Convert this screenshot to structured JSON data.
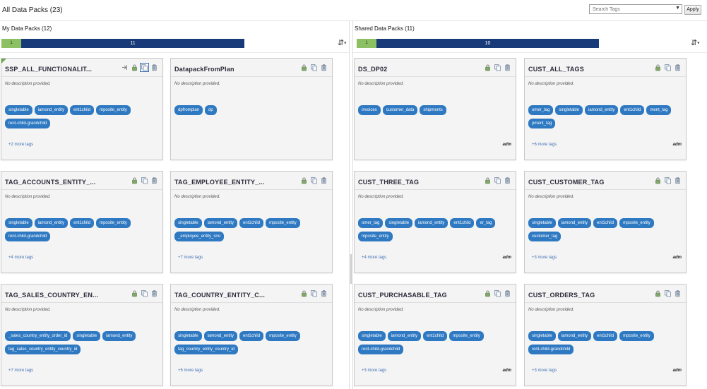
{
  "header": {
    "title": "All Data Packs (23)",
    "search_placeholder": "Search Tags",
    "apply_label": "Apply"
  },
  "left": {
    "title": "My Data Packs (12)",
    "bar": {
      "green_label": "1",
      "blue_label": "11"
    },
    "cards": [
      {
        "name": "SSP_ALL_FUNCTIONALIT...",
        "desc": "No description provided.",
        "tags": [
          "singletable",
          "iamond_entity",
          "ent1child",
          "mposite_entity",
          "rent-child-grandchild"
        ],
        "more": "+2 more tags",
        "owner": "",
        "icons": [
          "share",
          "lock",
          "copy",
          "trash"
        ],
        "new": true
      },
      {
        "name": "DatapackFromPlan",
        "desc": "No description provided.",
        "tags": [
          "dpfromplan",
          "dp"
        ],
        "more": "",
        "owner": "",
        "icons": [
          "lock",
          "copy",
          "trash"
        ],
        "new": false
      },
      {
        "name": "TAG_ACCOUNTS_ENTITY_...",
        "desc": "No description provided.",
        "tags": [
          "singletable",
          "iamond_entity",
          "ent1child",
          "mposite_entity",
          "rent-child-grandchild"
        ],
        "more": "+4 more tags",
        "owner": "",
        "icons": [
          "lock",
          "copy",
          "trash"
        ],
        "new": false
      },
      {
        "name": "TAG_EMPLOYEE_ENTITY_...",
        "desc": "No description provided.",
        "tags": [
          "singletable",
          "iamond_entity",
          "ent1child",
          "mposite_entity",
          "_employee_entity_sno"
        ],
        "more": "+7 more tags",
        "owner": "",
        "icons": [
          "lock",
          "copy",
          "trash"
        ],
        "new": false
      },
      {
        "name": "TAG_SALES_COUNTRY_EN...",
        "desc": "No description provided.",
        "tags": [
          "_sales_country_entity_order_id",
          "singletable",
          "iamond_entity",
          "tag_sales_country_entity_country_id"
        ],
        "more": "+7 more tags",
        "owner": "",
        "icons": [
          "lock",
          "copy",
          "trash"
        ],
        "new": false
      },
      {
        "name": "TAG_COUNTRY_ENTITY_C...",
        "desc": "No description provided.",
        "tags": [
          "singletable",
          "iamond_entity",
          "ent1child",
          "mposite_entity",
          "tag_country_entity_country_id"
        ],
        "more": "+5 more tags",
        "owner": "",
        "icons": [
          "lock",
          "copy",
          "trash"
        ],
        "new": false
      }
    ]
  },
  "right": {
    "title": "Shared Data Packs (11)",
    "bar": {
      "green_label": "1",
      "blue_label": "10"
    },
    "cards": [
      {
        "name": "DS_DP02",
        "desc": "No description provided.",
        "tags": [
          "invoices",
          "customer_data",
          "shipments"
        ],
        "more": "",
        "owner": "adm",
        "icons": [
          "lock",
          "copy",
          "trash"
        ],
        "new": false
      },
      {
        "name": "CUST_ALL_TAGS",
        "desc": "No description provided.",
        "tags": [
          "omer_tag",
          "singletable",
          "iamond_entity",
          "ent1child",
          "ment_tag",
          "pment_tag"
        ],
        "more": "+6 more tags",
        "owner": "adm",
        "icons": [
          "lock",
          "copy",
          "trash"
        ],
        "new": false
      },
      {
        "name": "CUST_THREE_TAG",
        "desc": "No description provided.",
        "tags": [
          "omer_tag",
          "singletable",
          "iamond_entity",
          "ent1child",
          "er_tag",
          "mposite_entity"
        ],
        "more": "+4 more tags",
        "owner": "adm",
        "icons": [
          "lock",
          "copy",
          "trash"
        ],
        "new": false
      },
      {
        "name": "CUST_CUSTOMER_TAG",
        "desc": "No description provided.",
        "tags": [
          "singletable",
          "iamond_entity",
          "ent1child",
          "mposite_entity",
          "customer_tag"
        ],
        "more": "+3 more tags",
        "owner": "adm",
        "icons": [
          "lock",
          "copy",
          "trash"
        ],
        "new": false
      },
      {
        "name": "CUST_PURCHASABLE_TAG",
        "desc": "No description provided.",
        "tags": [
          "singletable",
          "iamond_entity",
          "ent1child",
          "mposite_entity",
          "rent-child-grandchild"
        ],
        "more": "+3 more tags",
        "owner": "adm",
        "icons": [
          "lock",
          "copy",
          "trash"
        ],
        "new": false
      },
      {
        "name": "CUST_ORDERS_TAG",
        "desc": "No description provided.",
        "tags": [
          "singletable",
          "iamond_entity",
          "ent1child",
          "mposite_entity",
          "rent-child-grandchild"
        ],
        "more": "+3 more tags",
        "owner": "adm",
        "icons": [
          "lock",
          "copy",
          "trash"
        ],
        "new": false
      }
    ]
  },
  "colors": {
    "accent_blue": "#2e79c2",
    "bar_blue": "#183a78",
    "bar_green": "#8cc063",
    "link_blue": "#3f6fb5"
  }
}
